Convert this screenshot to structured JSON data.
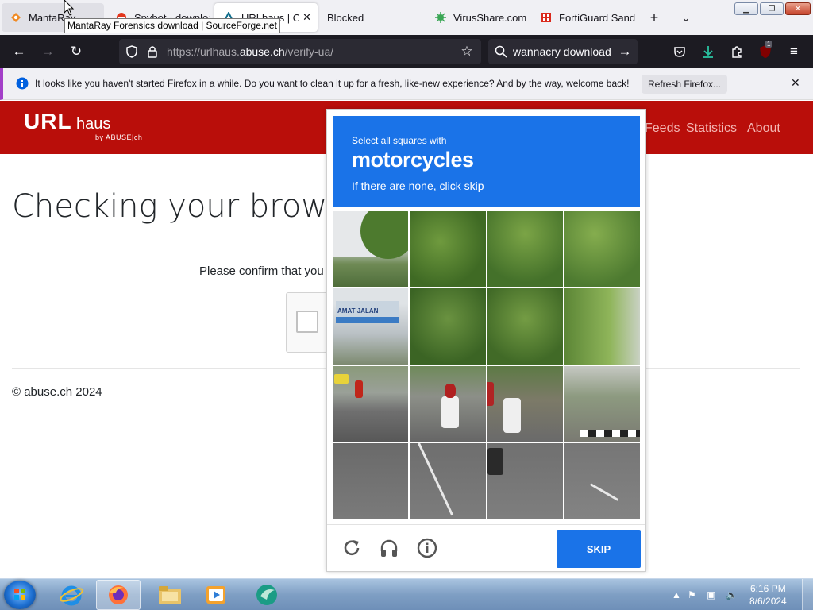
{
  "browser": {
    "tabs": [
      {
        "label": "MantaRay"
      },
      {
        "label": "Spybot - download"
      },
      {
        "label": "URLhaus | Checking your browser"
      },
      {
        "label": "Blocked"
      },
      {
        "label": "VirusShare.com"
      },
      {
        "label": "FortiGuard Sandbox"
      }
    ],
    "tooltip": "MantaRay Forensics download | SourceForge.net",
    "url_prefix": "https://urlhaus.",
    "url_domain": "abuse.ch",
    "url_path": "/verify-ua/",
    "search_query": "wannacry download",
    "extension_badge": "1"
  },
  "notification": {
    "text": "It looks like you haven't started Firefox in a while. Do you want to clean it up for a fresh, like-new experience? And by the way, welcome back!",
    "button": "Refresh Firefox..."
  },
  "site": {
    "logo_url": "URL",
    "logo_haus": "haus",
    "logo_sub": "by ABUSE|ch",
    "nav": [
      "Feeds",
      "Statistics",
      "About"
    ],
    "title": "Checking your browser",
    "confirm": "Please confirm that you",
    "footer": "© abuse.ch 2024"
  },
  "captcha": {
    "line1": "Select all squares with",
    "target": "motorcycles",
    "line3": "If there are none, click skip",
    "skip": "SKIP",
    "sign_text": "AMAT JALAN"
  },
  "taskbar": {
    "time": "6:16 PM",
    "date": "8/6/2024"
  }
}
